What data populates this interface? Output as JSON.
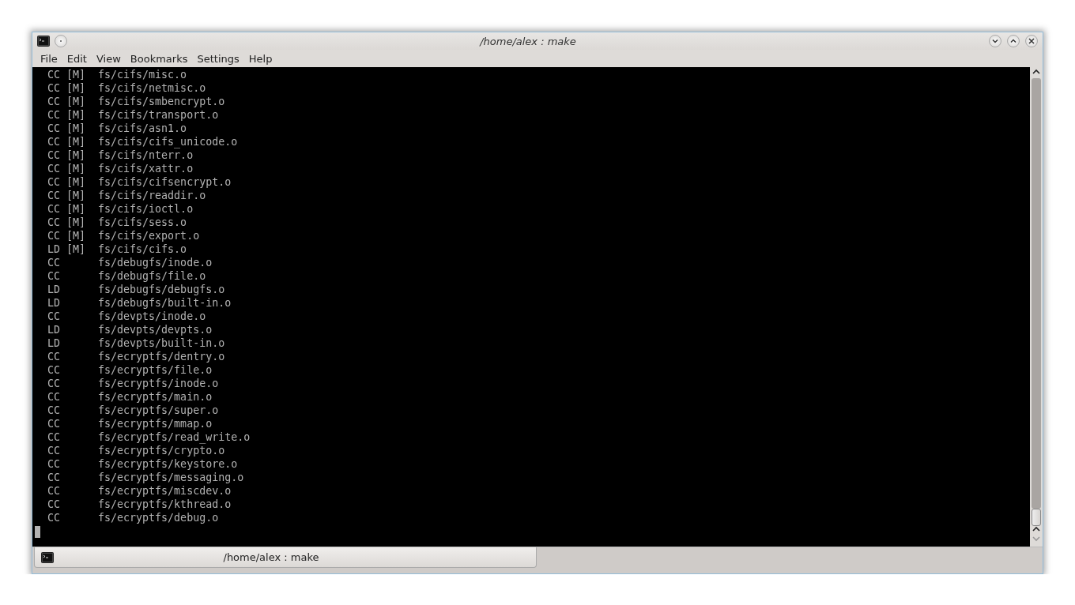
{
  "window": {
    "title": "/home/alex : make"
  },
  "menu": [
    "File",
    "Edit",
    "View",
    "Bookmarks",
    "Settings",
    "Help"
  ],
  "terminal": {
    "lines": [
      "  CC [M]  fs/cifs/misc.o",
      "  CC [M]  fs/cifs/netmisc.o",
      "  CC [M]  fs/cifs/smbencrypt.o",
      "  CC [M]  fs/cifs/transport.o",
      "  CC [M]  fs/cifs/asn1.o",
      "  CC [M]  fs/cifs/cifs_unicode.o",
      "  CC [M]  fs/cifs/nterr.o",
      "  CC [M]  fs/cifs/xattr.o",
      "  CC [M]  fs/cifs/cifsencrypt.o",
      "  CC [M]  fs/cifs/readdir.o",
      "  CC [M]  fs/cifs/ioctl.o",
      "  CC [M]  fs/cifs/sess.o",
      "  CC [M]  fs/cifs/export.o",
      "  LD [M]  fs/cifs/cifs.o",
      "  CC      fs/debugfs/inode.o",
      "  CC      fs/debugfs/file.o",
      "  LD      fs/debugfs/debugfs.o",
      "  LD      fs/debugfs/built-in.o",
      "  CC      fs/devpts/inode.o",
      "  LD      fs/devpts/devpts.o",
      "  LD      fs/devpts/built-in.o",
      "  CC      fs/ecryptfs/dentry.o",
      "  CC      fs/ecryptfs/file.o",
      "  CC      fs/ecryptfs/inode.o",
      "  CC      fs/ecryptfs/main.o",
      "  CC      fs/ecryptfs/super.o",
      "  CC      fs/ecryptfs/mmap.o",
      "  CC      fs/ecryptfs/read_write.o",
      "  CC      fs/ecryptfs/crypto.o",
      "  CC      fs/ecryptfs/keystore.o",
      "  CC      fs/ecryptfs/messaging.o",
      "  CC      fs/ecryptfs/miscdev.o",
      "  CC      fs/ecryptfs/kthread.o",
      "  CC      fs/ecryptfs/debug.o"
    ]
  },
  "tabs": [
    {
      "label": "/home/alex : make",
      "selected": true
    }
  ]
}
